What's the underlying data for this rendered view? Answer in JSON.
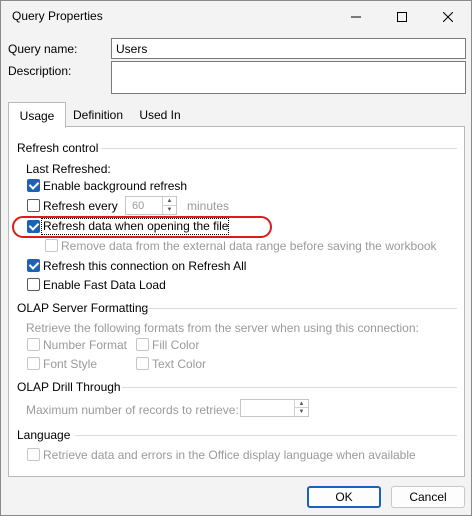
{
  "window": {
    "title": "Query Properties"
  },
  "form": {
    "name_label": "Query name:",
    "name_value": "Users",
    "description_label": "Description:",
    "description_value": ""
  },
  "tabs": [
    {
      "label": "Usage",
      "active": true
    },
    {
      "label": "Definition",
      "active": false
    },
    {
      "label": "Used In",
      "active": false
    }
  ],
  "usage": {
    "refresh_control": {
      "heading": "Refresh control",
      "last_refreshed": "Last Refreshed:",
      "background_refresh": {
        "label": "Enable background refresh",
        "checked": true
      },
      "refresh_every": {
        "label": "Refresh every",
        "checked": false,
        "value": "60",
        "unit": "minutes"
      },
      "refresh_on_open": {
        "label": "Refresh data when opening the file",
        "checked": true
      },
      "remove_data": {
        "label": "Remove data from the external data range before saving the workbook",
        "checked": false,
        "enabled": false
      },
      "refresh_all": {
        "label": "Refresh this connection on Refresh All",
        "checked": true
      },
      "fast_load": {
        "label": "Enable Fast Data Load",
        "checked": false
      }
    },
    "olap_formatting": {
      "heading": "OLAP Server Formatting",
      "description": "Retrieve the following formats from the server when using this connection:",
      "number_format": "Number Format",
      "fill_color": "Fill Color",
      "font_style": "Font Style",
      "text_color": "Text Color"
    },
    "olap_drill": {
      "heading": "OLAP Drill Through",
      "max_records_label": "Maximum number of records to retrieve:",
      "max_records_value": ""
    },
    "language": {
      "heading": "Language",
      "retrieve_label": "Retrieve data and errors in the Office display language when available"
    }
  },
  "buttons": {
    "ok": "OK",
    "cancel": "Cancel"
  },
  "colors": {
    "accent": "#1a63b8",
    "annotation": "#e01a1a"
  }
}
